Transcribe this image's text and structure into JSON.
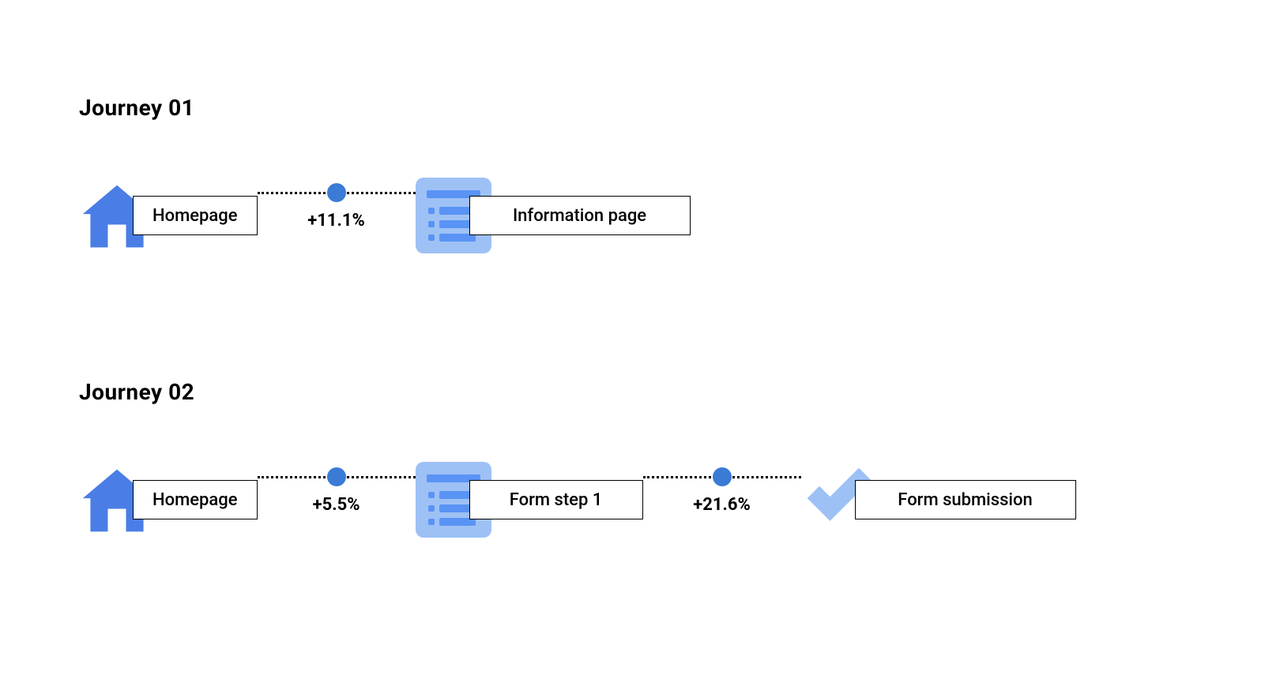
{
  "colors": {
    "icon_primary": "#4a7ee6",
    "icon_light": "#9ec1f5",
    "dot": "#3a7bd5"
  },
  "journeys": [
    {
      "title": "Journey 01",
      "steps": [
        {
          "icon": "home",
          "label": "Homepage"
        },
        {
          "icon": "list",
          "label": "Information page"
        }
      ],
      "connectors": [
        {
          "delta": "+11.1%"
        }
      ]
    },
    {
      "title": "Journey 02",
      "steps": [
        {
          "icon": "home",
          "label": "Homepage"
        },
        {
          "icon": "list",
          "label": "Form step 1"
        },
        {
          "icon": "check",
          "label": "Form submission"
        }
      ],
      "connectors": [
        {
          "delta": "+5.5%"
        },
        {
          "delta": "+21.6%"
        }
      ]
    }
  ]
}
